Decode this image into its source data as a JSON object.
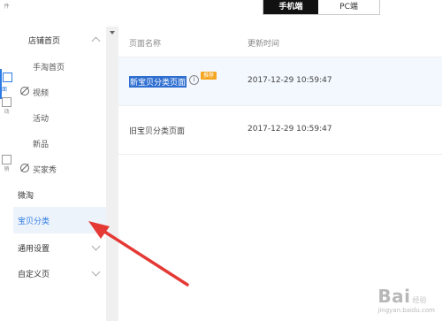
{
  "rail": {
    "items": [
      {
        "label": "件"
      },
      {
        "label": "面",
        "active": true
      },
      {
        "label": "动"
      },
      {
        "label": "销"
      }
    ]
  },
  "topbar": {
    "tabs": [
      {
        "label": "手机端",
        "active": true
      },
      {
        "label": "PC端",
        "active": false
      }
    ]
  },
  "sidebar": {
    "groups": [
      {
        "label": "店铺首页",
        "expanded": true,
        "items": [
          {
            "label": "手淘首页"
          },
          {
            "label": "视频"
          },
          {
            "label": "活动"
          },
          {
            "label": "新品"
          },
          {
            "label": "买家秀"
          }
        ]
      },
      {
        "label": "微淘"
      },
      {
        "label": "宝贝分类",
        "active": true
      },
      {
        "label": "通用设置",
        "expanded": false
      },
      {
        "label": "自定义页",
        "expanded": false
      }
    ]
  },
  "table": {
    "headers": {
      "name": "页面名称",
      "time": "更新时间"
    },
    "rows": [
      {
        "name": "新宝贝分类页面",
        "tag": "推荐",
        "time": "2017-12-29 10:59:47",
        "selected": true
      },
      {
        "name": "旧宝贝分类页面",
        "time": "2017-12-29 10:59:47",
        "selected": false
      }
    ]
  },
  "annotation": {
    "color": "#e53935"
  },
  "watermark": {
    "brand": "Bai",
    "suffix": "经验",
    "url": "jingyan.baidu.com"
  }
}
